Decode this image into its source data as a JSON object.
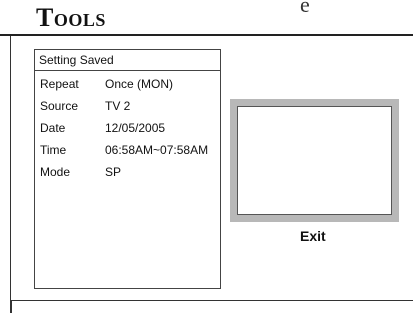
{
  "header": {
    "title": "Tools",
    "cropped_text": "e"
  },
  "panel": {
    "title": "Setting Saved",
    "rows": [
      {
        "label": "Repeat",
        "value": "Once (MON)"
      },
      {
        "label": "Source",
        "value": "TV  2"
      },
      {
        "label": "Date",
        "value": "12/05/2005"
      },
      {
        "label": "Time",
        "value": "06:58AM~07:58AM"
      },
      {
        "label": "Mode",
        "value": "SP"
      }
    ]
  },
  "preview": {
    "exit_label": "Exit"
  }
}
